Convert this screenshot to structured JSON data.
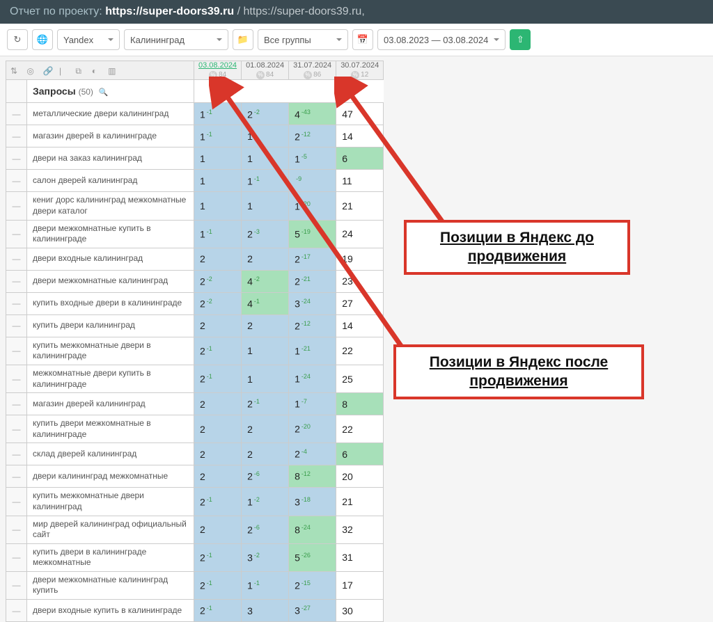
{
  "header": {
    "label": "Отчет по проекту:",
    "link1": "https://super-doors39.ru",
    "link2": "https://super-doors39.ru,"
  },
  "toolbar": {
    "engine": "Yandex",
    "region": "Калининград",
    "groups": "Все группы",
    "dates": "03.08.2023 — 03.08.2024"
  },
  "table": {
    "queries_label": "Запросы",
    "queries_count": "(50)",
    "dates": [
      {
        "text": "03.08.2024",
        "pct": "84",
        "link": true
      },
      {
        "text": "01.08.2024",
        "pct": "84",
        "link": false
      },
      {
        "text": "31.07.2024",
        "pct": "86",
        "link": false
      },
      {
        "text": "30.07.2024",
        "pct": "12",
        "link": false
      }
    ],
    "rows": [
      {
        "q": "металлические двери калининград",
        "cells": [
          {
            "v": "1",
            "d": "-1",
            "bg": "blue"
          },
          {
            "v": "2",
            "d": "-2",
            "bg": "blue"
          },
          {
            "v": "4",
            "d": "-43",
            "bg": "green"
          },
          {
            "v": "47",
            "d": "",
            "bg": "white"
          }
        ]
      },
      {
        "q": "магазин дверей в калининграде",
        "cells": [
          {
            "v": "1",
            "d": "-1",
            "bg": "blue"
          },
          {
            "v": "1",
            "d": "",
            "bg": "blue"
          },
          {
            "v": "2",
            "d": "-12",
            "bg": "blue"
          },
          {
            "v": "14",
            "d": "",
            "bg": "white"
          }
        ]
      },
      {
        "q": "двери на заказ калининград",
        "cells": [
          {
            "v": "1",
            "d": "",
            "bg": "blue"
          },
          {
            "v": "1",
            "d": "",
            "bg": "blue"
          },
          {
            "v": "1",
            "d": "-5",
            "bg": "blue"
          },
          {
            "v": "6",
            "d": "",
            "bg": "green"
          }
        ]
      },
      {
        "q": "салон дверей калининград",
        "cells": [
          {
            "v": "1",
            "d": "",
            "bg": "blue"
          },
          {
            "v": "1",
            "d": "-1",
            "bg": "blue"
          },
          {
            "v": "",
            "d": "-9",
            "bg": "blue"
          },
          {
            "v": "11",
            "d": "",
            "bg": "white"
          }
        ]
      },
      {
        "q": "кениг дорс калининград межкомнатные двери каталог",
        "cells": [
          {
            "v": "1",
            "d": "",
            "bg": "blue"
          },
          {
            "v": "1",
            "d": "",
            "bg": "blue"
          },
          {
            "v": "1",
            "d": "-20",
            "bg": "blue"
          },
          {
            "v": "21",
            "d": "",
            "bg": "white"
          }
        ]
      },
      {
        "q": "двери межкомнатные купить в калининграде",
        "cells": [
          {
            "v": "1",
            "d": "-1",
            "bg": "blue"
          },
          {
            "v": "2",
            "d": "-3",
            "bg": "blue"
          },
          {
            "v": "5",
            "d": "-19",
            "bg": "green"
          },
          {
            "v": "24",
            "d": "",
            "bg": "white"
          }
        ]
      },
      {
        "q": "двери входные калининград",
        "cells": [
          {
            "v": "2",
            "d": "",
            "bg": "blue"
          },
          {
            "v": "2",
            "d": "",
            "bg": "blue"
          },
          {
            "v": "2",
            "d": "-17",
            "bg": "blue"
          },
          {
            "v": "19",
            "d": "",
            "bg": "white"
          }
        ]
      },
      {
        "q": "двери межкомнатные калининград",
        "cells": [
          {
            "v": "2",
            "d": "-2",
            "bg": "blue"
          },
          {
            "v": "4",
            "d": "-2",
            "bg": "green"
          },
          {
            "v": "2",
            "d": "-21",
            "bg": "blue"
          },
          {
            "v": "23",
            "d": "",
            "bg": "white"
          }
        ]
      },
      {
        "q": "купить входные двери в калининграде",
        "cells": [
          {
            "v": "2",
            "d": "-2",
            "bg": "blue"
          },
          {
            "v": "4",
            "d": "-1",
            "bg": "green"
          },
          {
            "v": "3",
            "d": "-24",
            "bg": "blue"
          },
          {
            "v": "27",
            "d": "",
            "bg": "white"
          }
        ]
      },
      {
        "q": "купить двери калининград",
        "cells": [
          {
            "v": "2",
            "d": "",
            "bg": "blue"
          },
          {
            "v": "2",
            "d": "",
            "bg": "blue"
          },
          {
            "v": "2",
            "d": "-12",
            "bg": "blue"
          },
          {
            "v": "14",
            "d": "",
            "bg": "white"
          }
        ]
      },
      {
        "q": "купить межкомнатные двери в калининграде",
        "cells": [
          {
            "v": "2",
            "d": "-1",
            "bg": "blue"
          },
          {
            "v": "1",
            "d": "",
            "bg": "blue"
          },
          {
            "v": "1",
            "d": "-21",
            "bg": "blue"
          },
          {
            "v": "22",
            "d": "",
            "bg": "white"
          }
        ]
      },
      {
        "q": "межкомнатные двери купить в калининграде",
        "cells": [
          {
            "v": "2",
            "d": "-1",
            "bg": "blue"
          },
          {
            "v": "1",
            "d": "",
            "bg": "blue"
          },
          {
            "v": "1",
            "d": "-24",
            "bg": "blue"
          },
          {
            "v": "25",
            "d": "",
            "bg": "white"
          }
        ]
      },
      {
        "q": "магазин дверей калининград",
        "cells": [
          {
            "v": "2",
            "d": "",
            "bg": "blue"
          },
          {
            "v": "2",
            "d": "-1",
            "bg": "blue"
          },
          {
            "v": "1",
            "d": "-7",
            "bg": "blue"
          },
          {
            "v": "8",
            "d": "",
            "bg": "green"
          }
        ]
      },
      {
        "q": "купить двери межкомнатные в калининграде",
        "cells": [
          {
            "v": "2",
            "d": "",
            "bg": "blue"
          },
          {
            "v": "2",
            "d": "",
            "bg": "blue"
          },
          {
            "v": "2",
            "d": "-20",
            "bg": "blue"
          },
          {
            "v": "22",
            "d": "",
            "bg": "white"
          }
        ]
      },
      {
        "q": "склад дверей калининград",
        "cells": [
          {
            "v": "2",
            "d": "",
            "bg": "blue"
          },
          {
            "v": "2",
            "d": "",
            "bg": "blue"
          },
          {
            "v": "2",
            "d": "-4",
            "bg": "blue"
          },
          {
            "v": "6",
            "d": "",
            "bg": "green"
          }
        ]
      },
      {
        "q": "двери калининград межкомнатные",
        "cells": [
          {
            "v": "2",
            "d": "",
            "bg": "blue"
          },
          {
            "v": "2",
            "d": "-6",
            "bg": "blue"
          },
          {
            "v": "8",
            "d": "-12",
            "bg": "green"
          },
          {
            "v": "20",
            "d": "",
            "bg": "white"
          }
        ]
      },
      {
        "q": "купить межкомнатные двери калининград",
        "cells": [
          {
            "v": "2",
            "d": "-1",
            "bg": "blue"
          },
          {
            "v": "1",
            "d": "-2",
            "bg": "blue"
          },
          {
            "v": "3",
            "d": "-18",
            "bg": "blue"
          },
          {
            "v": "21",
            "d": "",
            "bg": "white"
          }
        ]
      },
      {
        "q": "мир дверей калининград официальный сайт",
        "cells": [
          {
            "v": "2",
            "d": "",
            "bg": "blue"
          },
          {
            "v": "2",
            "d": "-6",
            "bg": "blue"
          },
          {
            "v": "8",
            "d": "-24",
            "bg": "green"
          },
          {
            "v": "32",
            "d": "",
            "bg": "white"
          }
        ]
      },
      {
        "q": "купить двери в калининграде межкомнатные",
        "cells": [
          {
            "v": "2",
            "d": "-1",
            "bg": "blue"
          },
          {
            "v": "3",
            "d": "-2",
            "bg": "blue"
          },
          {
            "v": "5",
            "d": "-26",
            "bg": "green"
          },
          {
            "v": "31",
            "d": "",
            "bg": "white"
          }
        ]
      },
      {
        "q": "двери межкомнатные калининград купить",
        "cells": [
          {
            "v": "2",
            "d": "-1",
            "bg": "blue"
          },
          {
            "v": "1",
            "d": "-1",
            "bg": "blue"
          },
          {
            "v": "2",
            "d": "-15",
            "bg": "blue"
          },
          {
            "v": "17",
            "d": "",
            "bg": "white"
          }
        ]
      },
      {
        "q": "двери входные купить в калининграде",
        "cells": [
          {
            "v": "2",
            "d": "-1",
            "bg": "blue"
          },
          {
            "v": "3",
            "d": "",
            "bg": "blue"
          },
          {
            "v": "3",
            "d": "-27",
            "bg": "blue"
          },
          {
            "v": "30",
            "d": "",
            "bg": "white"
          }
        ]
      }
    ]
  },
  "annotations": {
    "before": "Позиции в Яндекс до продвижения",
    "after": "Позиции в Яндекс после продвижения"
  }
}
